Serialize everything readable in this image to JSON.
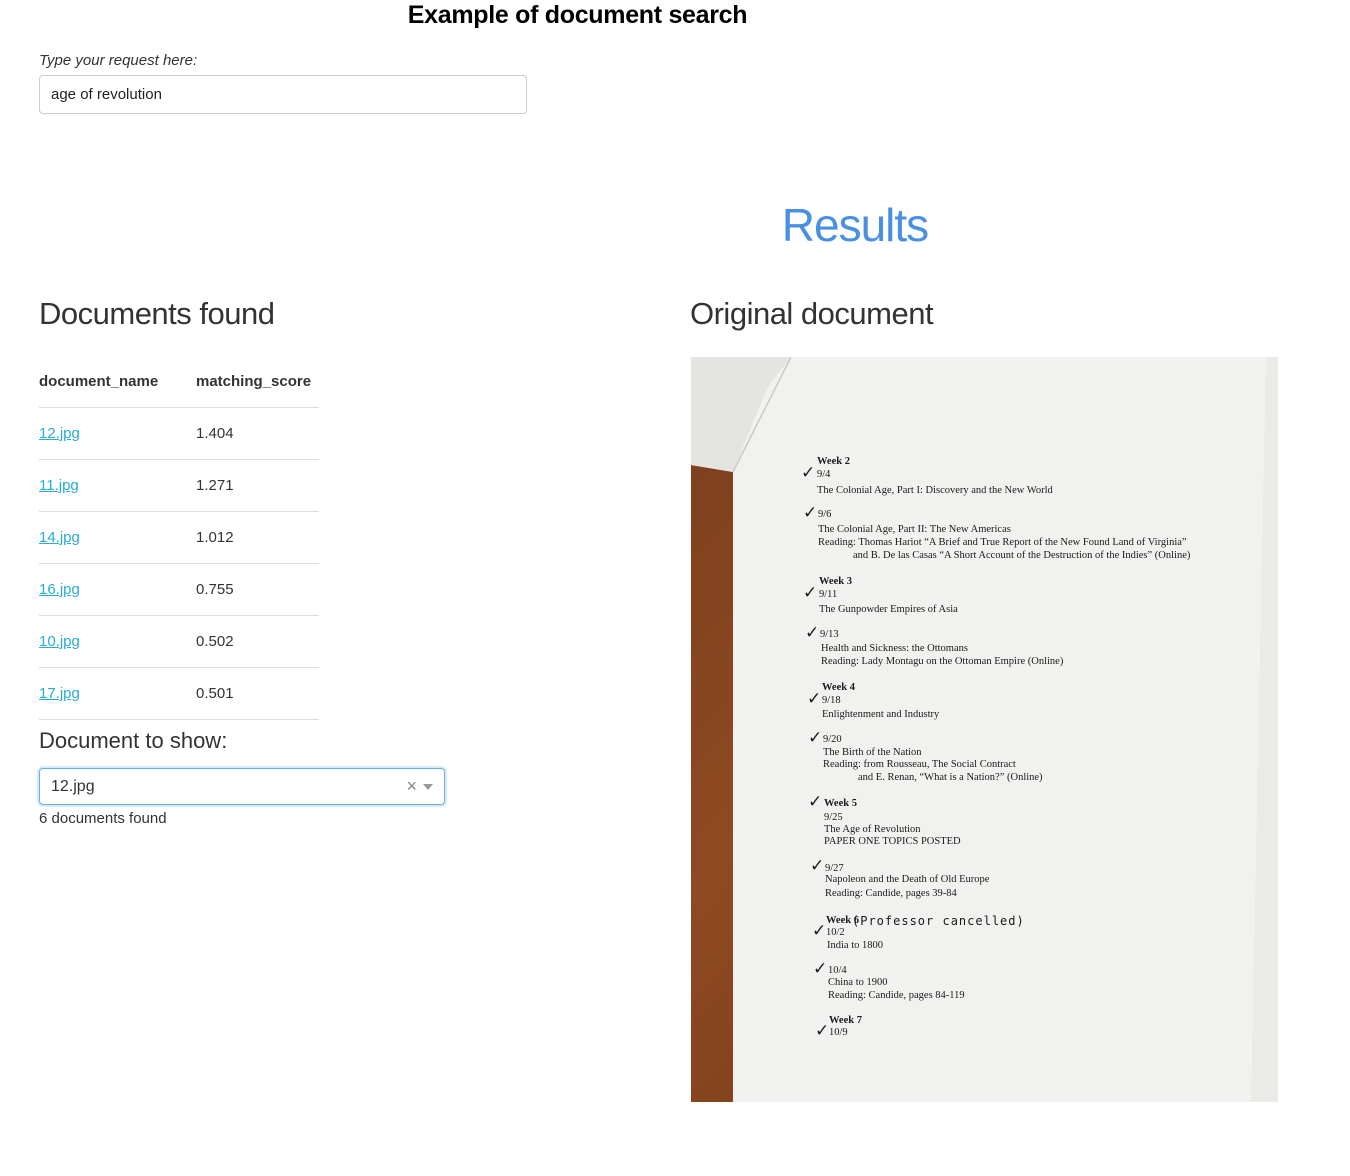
{
  "app_title": "Example of document search",
  "search": {
    "label": "Type your request here:",
    "value": "age of revolution"
  },
  "results_heading": "Results",
  "documents_found": {
    "heading": "Documents found",
    "columns": [
      "document_name",
      "matching_score"
    ],
    "rows": [
      {
        "name": "12.jpg",
        "score": "1.404"
      },
      {
        "name": "11.jpg",
        "score": "1.271"
      },
      {
        "name": "14.jpg",
        "score": "1.012"
      },
      {
        "name": "16.jpg",
        "score": "0.755"
      },
      {
        "name": "10.jpg",
        "score": "0.502"
      },
      {
        "name": "17.jpg",
        "score": "0.501"
      }
    ]
  },
  "document_to_show": {
    "label": "Document to show:",
    "selected": "12.jpg",
    "clear_glyph": "×",
    "count_text": "6 documents found"
  },
  "original_document": {
    "heading": "Original document",
    "lines": [
      "Week 2",
      "9/4",
      "The Colonial Age, Part I: Discovery and the New World",
      "9/6",
      "The Colonial Age, Part II: The New Americas",
      "Reading: Thomas Hariot “A Brief and True Report of the New Found Land of Virginia”",
      "and B. De las Casas “A Short Account of the Destruction of the Indies” (Online)",
      "Week 3",
      "9/11",
      "The Gunpowder Empires of Asia",
      "9/13",
      "Health and Sickness: the Ottomans",
      "Reading: Lady Montagu on the Ottoman Empire (Online)",
      "Week 4",
      "9/18",
      "Enlightenment and Industry",
      "9/20",
      "The Birth of the Nation",
      "Reading: from Rousseau, The Social Contract",
      "and E. Renan, “What is a Nation?” (Online)",
      "Week 5",
      "9/25",
      "The Age of Revolution",
      "PAPER ONE TOPICS POSTED",
      "9/27",
      "Napoleon and the Death of Old Europe",
      "Reading: Candide, pages 39-84",
      "Week 6",
      "10/2",
      "(Professor cancelled)",
      "India to 1800",
      "10/4",
      "China to 1900",
      "Reading: Candide, pages 84-119",
      "Week 7",
      "10/9"
    ],
    "check_glyph": "✓",
    "colors": {
      "table": "#7a3e1c",
      "paper": "#f1f1ef",
      "link": "#2aabd2",
      "results": "#4a90e2"
    }
  }
}
